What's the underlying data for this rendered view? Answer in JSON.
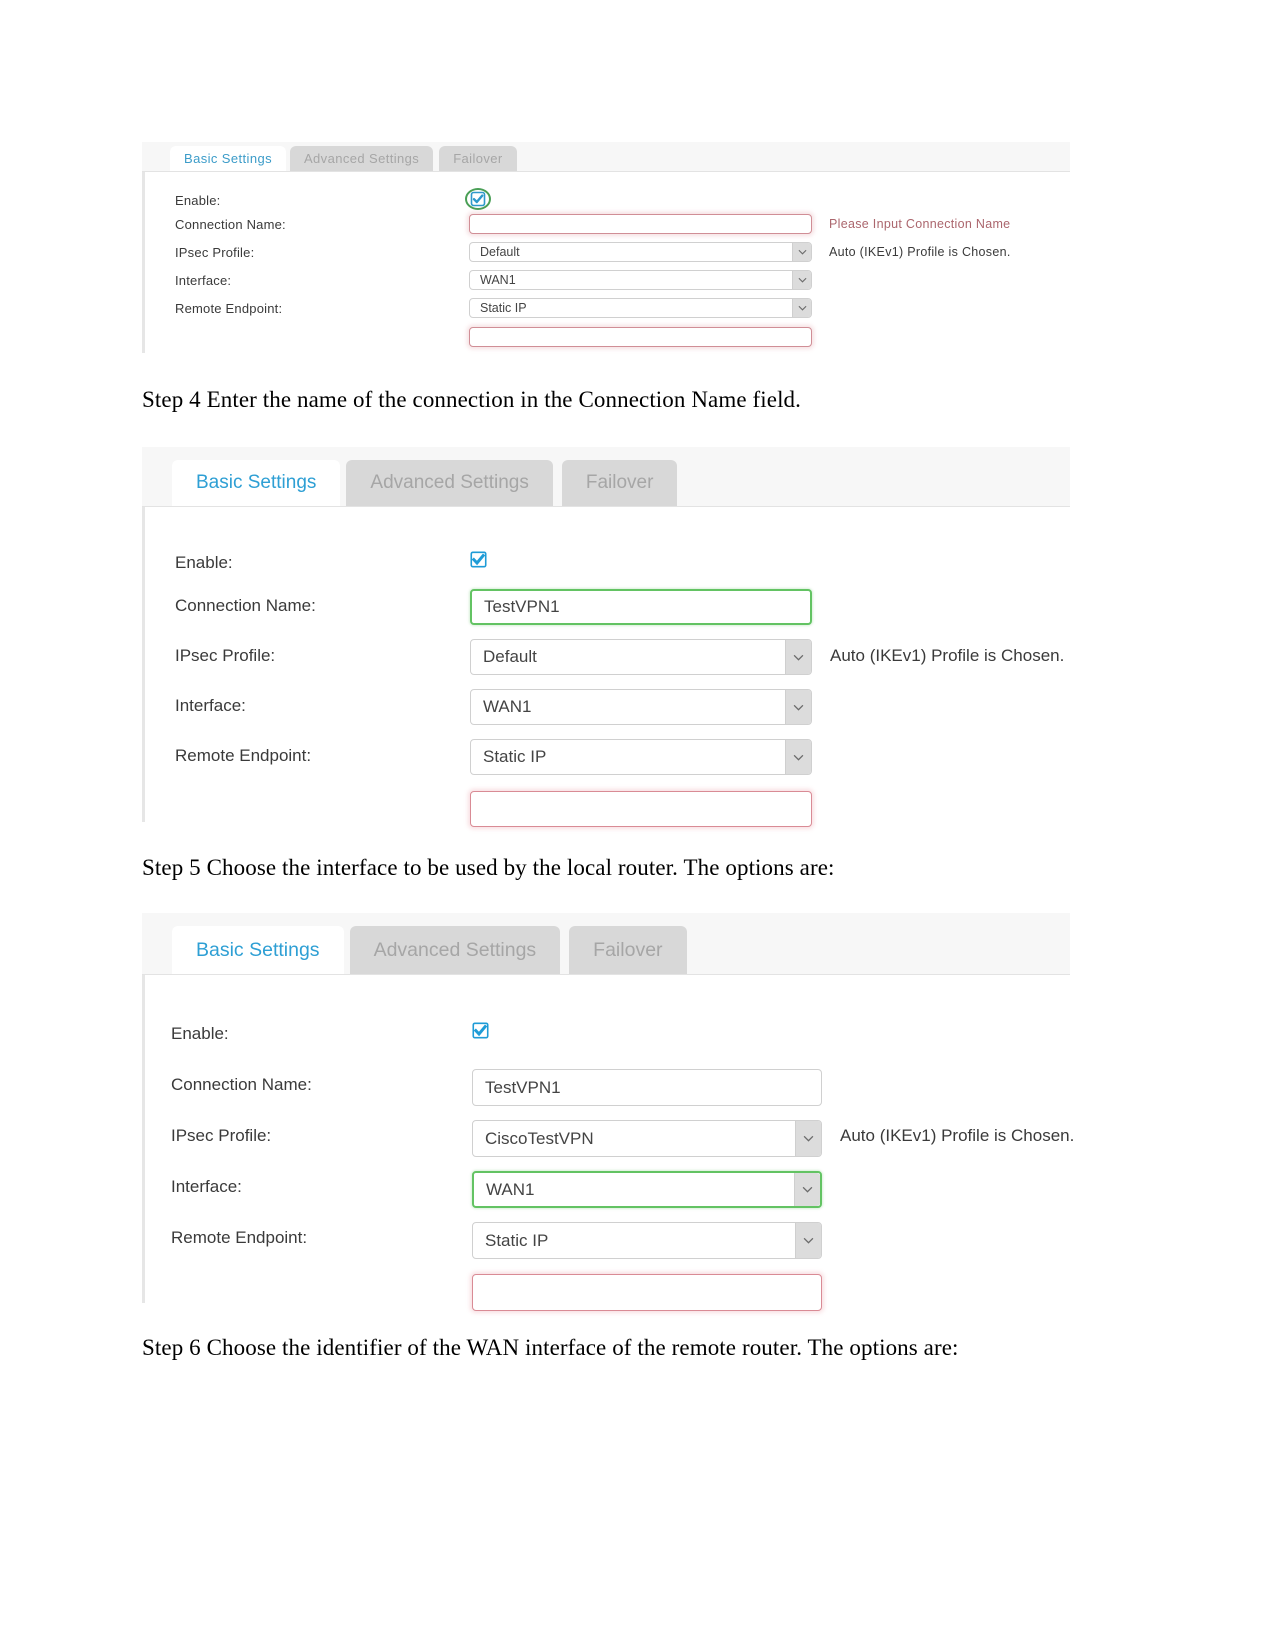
{
  "document": {
    "steps": [
      {
        "id": "step4",
        "text": "Step 4 Enter the name of the connection in the Connection Name field."
      },
      {
        "id": "step5",
        "text": "Step 5 Choose the interface to be used by the local router. The options are:"
      },
      {
        "id": "step6",
        "text": "Step 6 Choose the identifier of the WAN interface of the remote router. The options are:"
      }
    ]
  },
  "colors": {
    "active_tab_text": "#2e9fd4",
    "inactive_tab_bg": "#d8d8d8",
    "inactive_tab_text": "#a6a6a6",
    "error_border": "#d98b95",
    "error_hint_text": "#b5636c",
    "highlight_green": "#63c363",
    "checkbox_blue": "#1f9cd7",
    "ring_green": "#3fa34d",
    "panel_tabbar_bg": "#f7f7f7"
  },
  "panels": [
    {
      "id": "panel-1",
      "tabs": [
        {
          "label": "Basic Settings",
          "state": "active"
        },
        {
          "label": "Advanced Settings",
          "state": "inactive"
        },
        {
          "label": "Failover",
          "state": "inactive"
        }
      ],
      "rows": {
        "enable": {
          "label": "Enable:",
          "checked": true,
          "highlight": "ring"
        },
        "connection_name": {
          "label": "Connection Name:",
          "value": "",
          "placeholder": "",
          "state": "error",
          "hint": "Please Input Connection Name"
        },
        "ipsec_profile": {
          "label": "IPsec Profile:",
          "value": "Default",
          "state": "normal",
          "hint": "Auto (IKEv1) Profile is Chosen."
        },
        "interface": {
          "label": "Interface:",
          "value": "WAN1",
          "state": "normal",
          "hint": ""
        },
        "remote_endpoint": {
          "label": "Remote Endpoint:",
          "value": "Static IP",
          "state": "normal",
          "hint": ""
        },
        "remote_address": {
          "label": "",
          "value": "",
          "state": "error",
          "hint": ""
        }
      }
    },
    {
      "id": "panel-2",
      "tabs": [
        {
          "label": "Basic Settings",
          "state": "active"
        },
        {
          "label": "Advanced Settings",
          "state": "inactive"
        },
        {
          "label": "Failover",
          "state": "inactive"
        }
      ],
      "rows": {
        "enable": {
          "label": "Enable:",
          "checked": true,
          "highlight": "none"
        },
        "connection_name": {
          "label": "Connection Name:",
          "value": "TestVPN1",
          "state": "highlight",
          "hint": ""
        },
        "ipsec_profile": {
          "label": "IPsec Profile:",
          "value": "Default",
          "state": "normal",
          "hint": "Auto (IKEv1) Profile is Chosen."
        },
        "interface": {
          "label": "Interface:",
          "value": "WAN1",
          "state": "normal",
          "hint": ""
        },
        "remote_endpoint": {
          "label": "Remote Endpoint:",
          "value": "Static IP",
          "state": "normal",
          "hint": ""
        },
        "remote_address": {
          "label": "",
          "value": "",
          "state": "error",
          "hint": ""
        }
      }
    },
    {
      "id": "panel-3",
      "tabs": [
        {
          "label": "Basic Settings",
          "state": "active"
        },
        {
          "label": "Advanced Settings",
          "state": "inactive"
        },
        {
          "label": "Failover",
          "state": "inactive"
        }
      ],
      "rows": {
        "enable": {
          "label": "Enable:",
          "checked": true,
          "highlight": "none"
        },
        "connection_name": {
          "label": "Connection Name:",
          "value": "TestVPN1",
          "state": "normal",
          "hint": ""
        },
        "ipsec_profile": {
          "label": "IPsec Profile:",
          "value": "CiscoTestVPN",
          "state": "normal",
          "hint": "Auto (IKEv1) Profile is Chosen."
        },
        "interface": {
          "label": "Interface:",
          "value": "WAN1",
          "state": "highlight",
          "hint": ""
        },
        "remote_endpoint": {
          "label": "Remote Endpoint:",
          "value": "Static IP",
          "state": "normal",
          "hint": ""
        },
        "remote_address": {
          "label": "",
          "value": "",
          "state": "error",
          "hint": ""
        }
      }
    }
  ],
  "icons": {
    "chevron_down": "⌄",
    "checkmark": "✔"
  }
}
